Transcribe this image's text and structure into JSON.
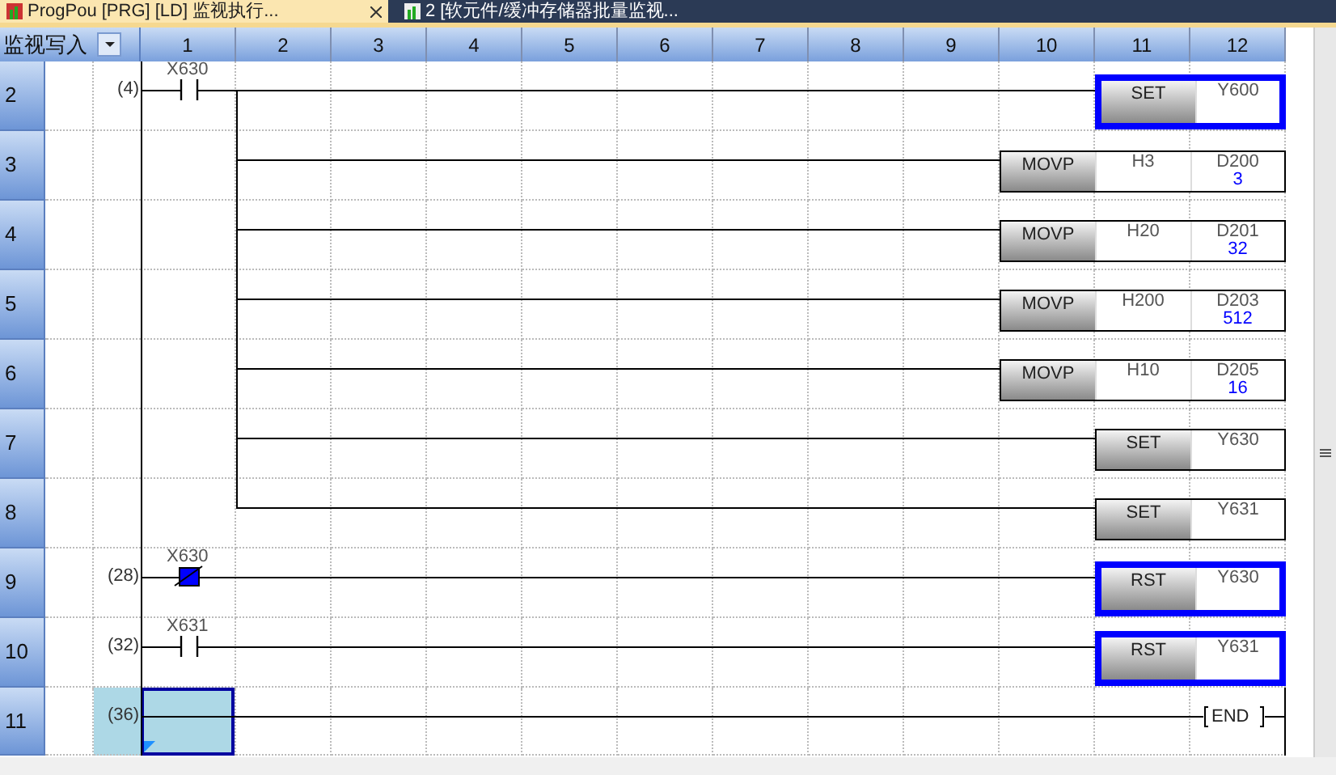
{
  "tabs": [
    {
      "label": "ProgPou [PRG] [LD] 监视执行...",
      "selected": true
    },
    {
      "label": "2 [软元件/缓冲存储器批量监视...",
      "selected": false
    }
  ],
  "corner_label": "监视写入",
  "columns": [
    "1",
    "2",
    "3",
    "4",
    "5",
    "6",
    "7",
    "8",
    "9",
    "10",
    "11",
    "12"
  ],
  "rungs": [
    {
      "row": "2",
      "step": "(4)",
      "contact": {
        "device": "X630",
        "on": false
      },
      "branch_up": false,
      "branch_down": true,
      "cursor": false,
      "instruction": {
        "kind": "output",
        "op": "SET",
        "operands": [
          {
            "device": "Y600"
          }
        ],
        "selected": true
      }
    },
    {
      "row": "3",
      "branch_up": true,
      "branch_down": true,
      "cursor": false,
      "instruction": {
        "kind": "move",
        "op": "MOVP",
        "operands": [
          {
            "device": "H3"
          },
          {
            "device": "D200",
            "value": "3"
          }
        ],
        "selected": false
      }
    },
    {
      "row": "4",
      "branch_up": true,
      "branch_down": true,
      "cursor": false,
      "instruction": {
        "kind": "move",
        "op": "MOVP",
        "operands": [
          {
            "device": "H20"
          },
          {
            "device": "D201",
            "value": "32"
          }
        ],
        "selected": false
      }
    },
    {
      "row": "5",
      "branch_up": true,
      "branch_down": true,
      "cursor": false,
      "instruction": {
        "kind": "move",
        "op": "MOVP",
        "operands": [
          {
            "device": "H200"
          },
          {
            "device": "D203",
            "value": "512"
          }
        ],
        "selected": false
      }
    },
    {
      "row": "6",
      "branch_up": true,
      "branch_down": true,
      "cursor": false,
      "instruction": {
        "kind": "move",
        "op": "MOVP",
        "operands": [
          {
            "device": "H10"
          },
          {
            "device": "D205",
            "value": "16"
          }
        ],
        "selected": false
      }
    },
    {
      "row": "7",
      "branch_up": true,
      "branch_down": true,
      "cursor": false,
      "instruction": {
        "kind": "output",
        "op": "SET",
        "operands": [
          {
            "device": "Y630"
          }
        ],
        "selected": false
      }
    },
    {
      "row": "8",
      "branch_up": true,
      "branch_down": false,
      "cursor": false,
      "instruction": {
        "kind": "output",
        "op": "SET",
        "operands": [
          {
            "device": "Y631"
          }
        ],
        "selected": false
      }
    },
    {
      "row": "9",
      "step": "(28)",
      "contact": {
        "device": "X630",
        "on": true
      },
      "branch_up": false,
      "branch_down": false,
      "cursor": false,
      "instruction": {
        "kind": "output",
        "op": "RST",
        "operands": [
          {
            "device": "Y630"
          }
        ],
        "selected": true
      }
    },
    {
      "row": "10",
      "step": "(32)",
      "contact": {
        "device": "X631",
        "on": false
      },
      "branch_up": false,
      "branch_down": false,
      "cursor": false,
      "instruction": {
        "kind": "output",
        "op": "RST",
        "operands": [
          {
            "device": "Y631"
          }
        ],
        "selected": true
      }
    },
    {
      "row": "11",
      "step": "(36)",
      "branch_up": false,
      "branch_down": false,
      "cursor": true,
      "instruction": {
        "kind": "end",
        "op": "END"
      }
    }
  ]
}
